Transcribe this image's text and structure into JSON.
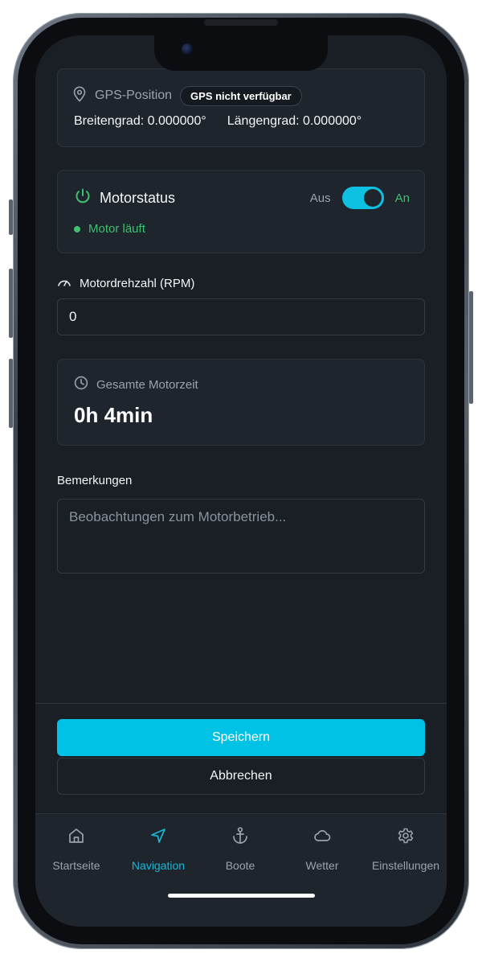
{
  "gps": {
    "title": "GPS-Position",
    "badge": "GPS nicht verfügbar",
    "latitude": "Breitengrad: 0.000000°",
    "longitude": "Längengrad: 0.000000°"
  },
  "motor": {
    "title": "Motorstatus",
    "off_label": "Aus",
    "on_label": "An",
    "toggle_on": true,
    "status_text": "Motor läuft"
  },
  "rpm": {
    "label": "Motordrehzahl (RPM)",
    "value": "0"
  },
  "total_time": {
    "label": "Gesamte Motorzeit",
    "value": "0h 4min"
  },
  "notes": {
    "label": "Bemerkungen",
    "placeholder": "Beobachtungen zum Motorbetrieb..."
  },
  "actions": {
    "save": "Speichern",
    "cancel": "Abbrechen"
  },
  "tabbar": {
    "items": [
      {
        "label": "Startseite",
        "icon": "home-icon",
        "active": false
      },
      {
        "label": "Navigation",
        "icon": "navigation-arrow-icon",
        "active": true
      },
      {
        "label": "Boote",
        "icon": "anchor-icon",
        "active": false
      },
      {
        "label": "Wetter",
        "icon": "cloud-icon",
        "active": false
      },
      {
        "label": "Einstellungen",
        "icon": "gear-icon",
        "active": false
      }
    ]
  },
  "colors": {
    "accent": "#00c2e4",
    "success": "#3fbf6f",
    "background": "#1a1f26",
    "card": "#1f252d"
  }
}
